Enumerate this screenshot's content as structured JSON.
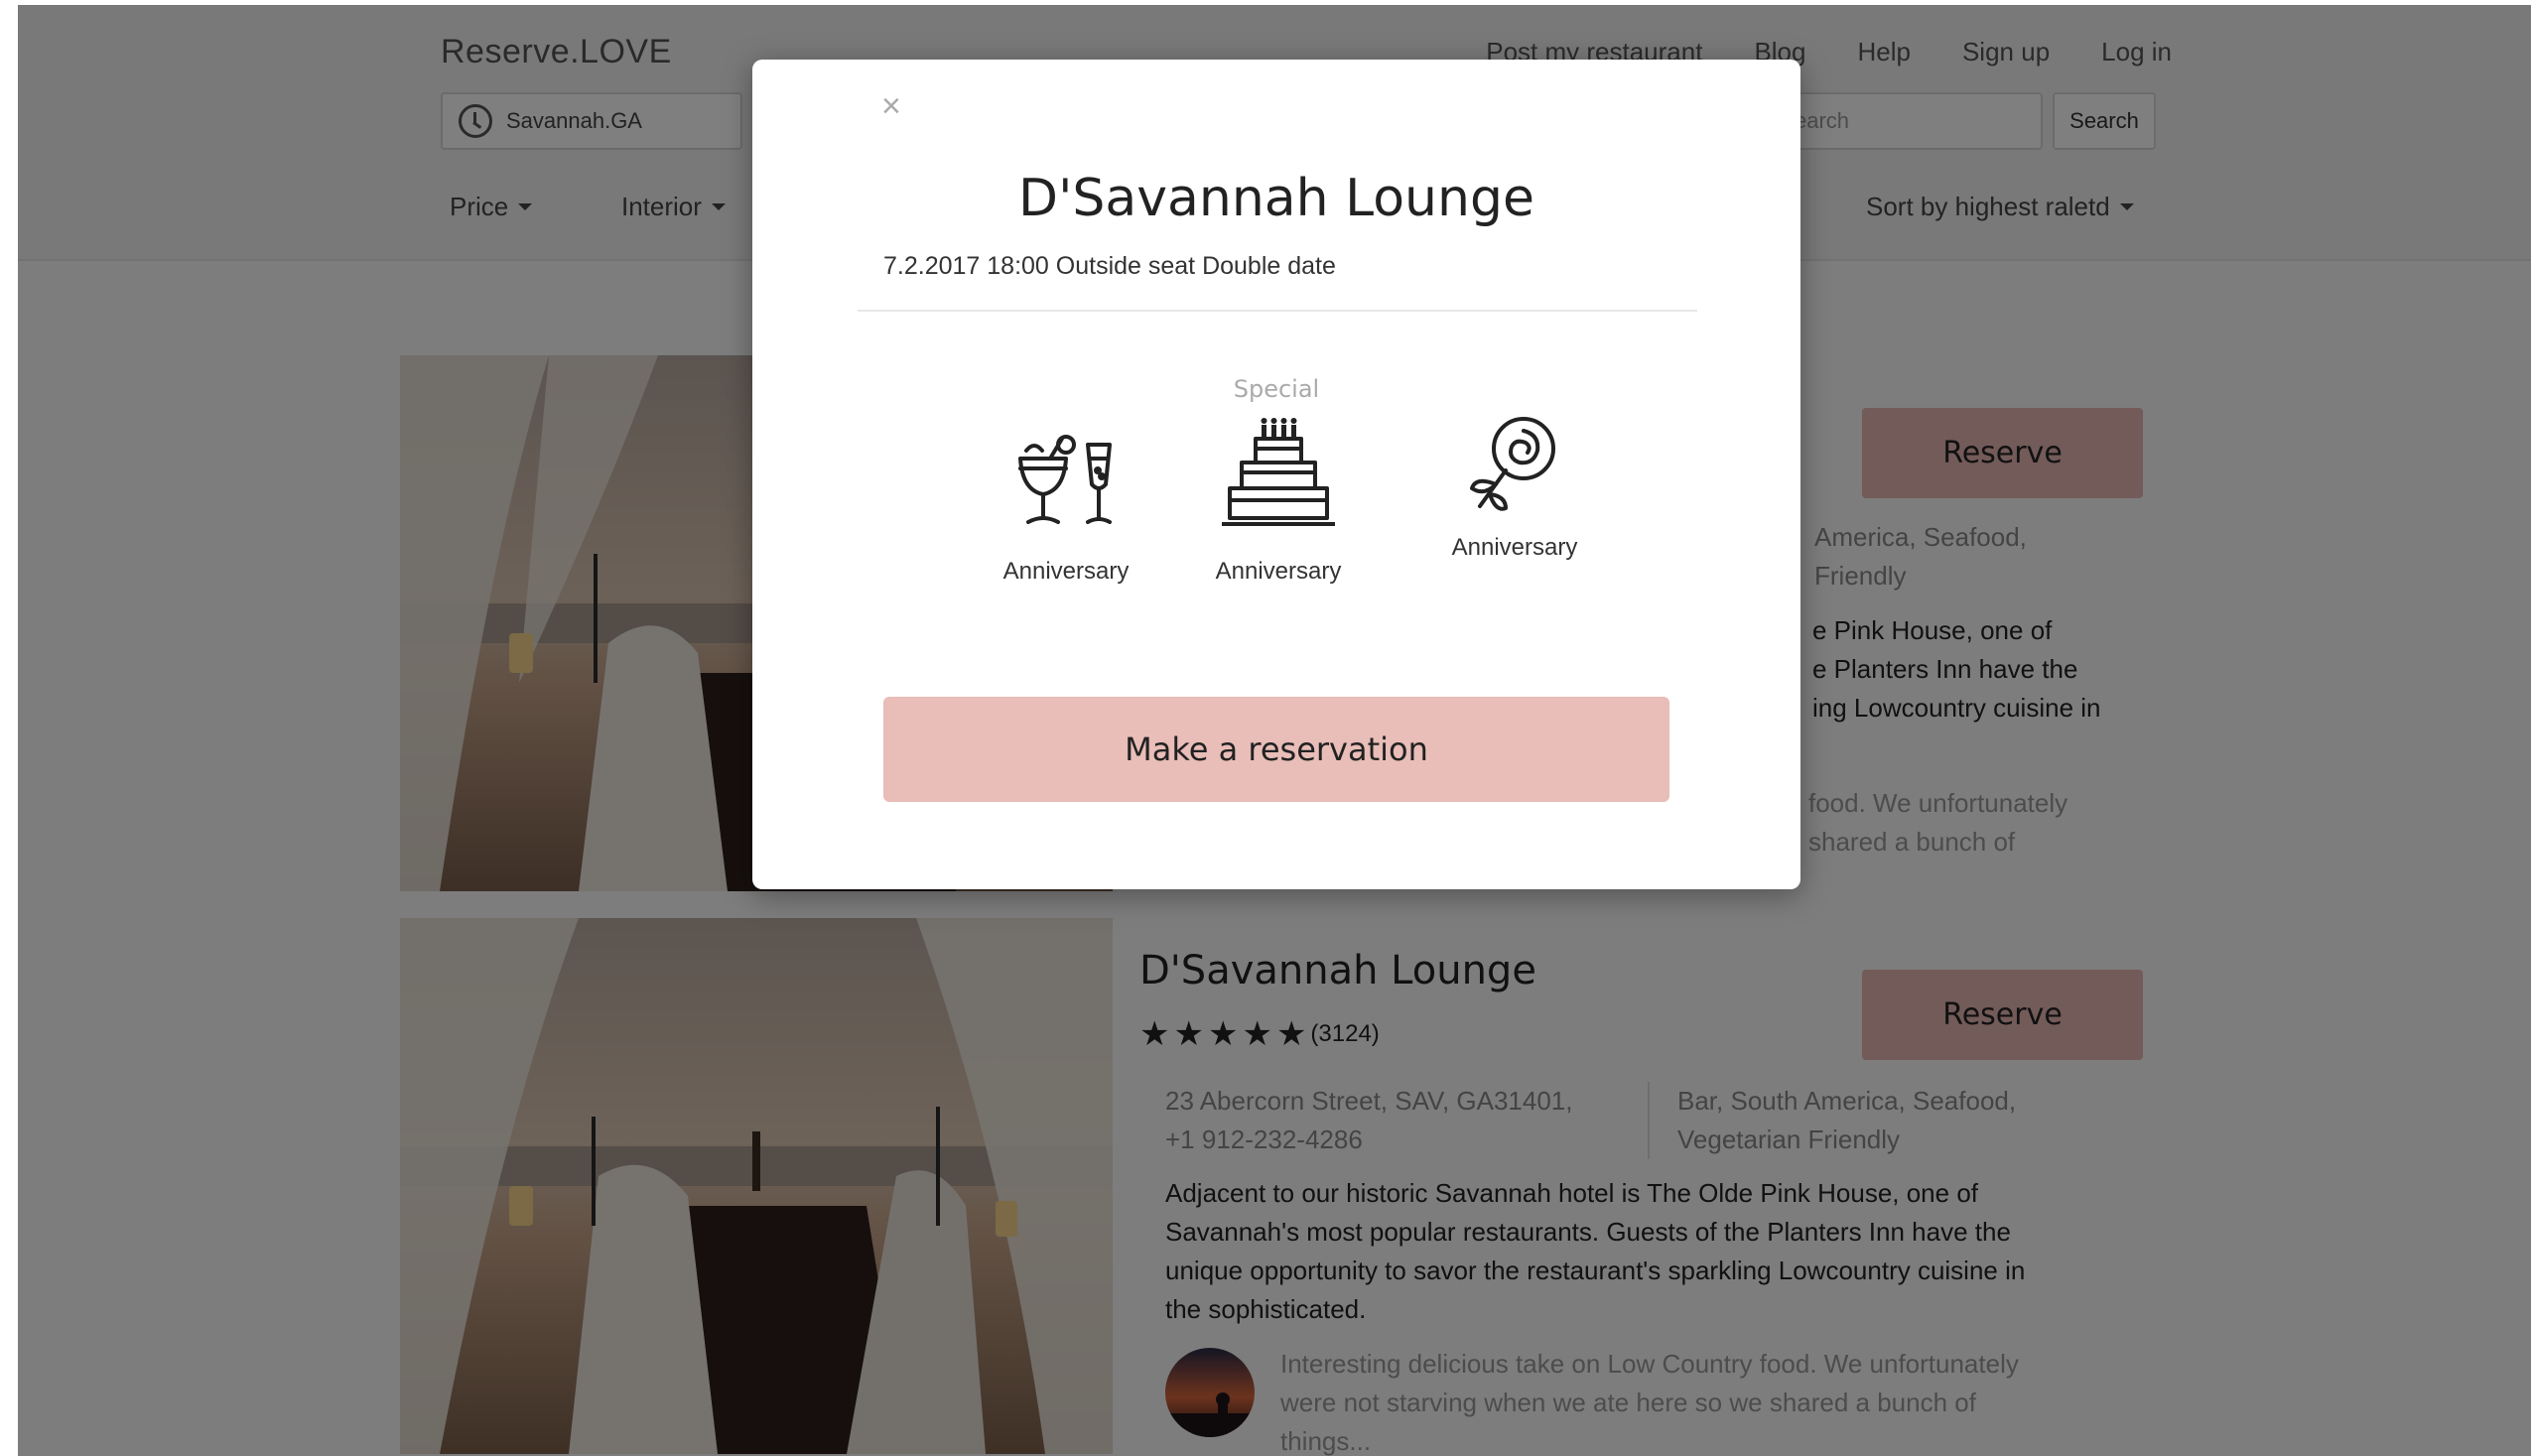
{
  "header": {
    "brand": "Reserve.LOVE",
    "nav": [
      "Post my restaurant",
      "Blog",
      "Help",
      "Sign up",
      "Log in"
    ],
    "location_value": "Savannah.GA",
    "search_placeholder": "earch",
    "search_button": "Search",
    "filters": {
      "price": "Price",
      "interior": "Interior",
      "sort": "Sort by highest raletd"
    }
  },
  "listings": [
    {
      "reserve_label": "Reserve",
      "cuisine_line1": "America, Seafood,",
      "cuisine_line2": "Friendly",
      "desc_line1": "e Pink House, one of",
      "desc_line2": "e Planters Inn have the",
      "desc_line3": "ing Lowcountry cuisine in",
      "review_line1": "food. We unfortunately",
      "review_line2": "shared a bunch of"
    },
    {
      "name": "D'Savannah Lounge",
      "review_count": "(3124)",
      "rating": 5,
      "address_line1": "23 Abercorn Street, SAV, GA31401,",
      "address_line2": "+1 912-232-4286",
      "cuisine_line1": "Bar, South America, Seafood,",
      "cuisine_line2": "Vegetarian Friendly",
      "desc_line1": "Adjacent to our historic Savannah hotel is The Olde Pink House, one of",
      "desc_line2": "Savannah's most popular restaurants. Guests of the Planters Inn have the",
      "desc_line3": "unique opportunity to savor the restaurant's sparkling Lowcountry cuisine in",
      "desc_line4": "the sophisticated.",
      "review_line1": "Interesting delicious take on Low Country food. We unfortunately",
      "review_line2": "were not starving when we ate here so we shared a bunch of",
      "review_line3": "things...",
      "reserve_label": "Reserve"
    }
  ],
  "modal": {
    "close_label": "×",
    "title": "D'Savannah Lounge",
    "subtitle": "7.2.2017 18:00 Outside seat Double date",
    "special_label": "Special",
    "options": [
      {
        "label": "Anniversary",
        "icon": "cocktails-icon"
      },
      {
        "label": "Anniversary",
        "icon": "cake-icon"
      },
      {
        "label": "Anniversary",
        "icon": "rose-icon"
      }
    ],
    "cta_label": "Make a reservation"
  },
  "colors": {
    "accent_pink": "#e9bdb8",
    "overlay": "rgba(0,0,0,0.5)"
  }
}
